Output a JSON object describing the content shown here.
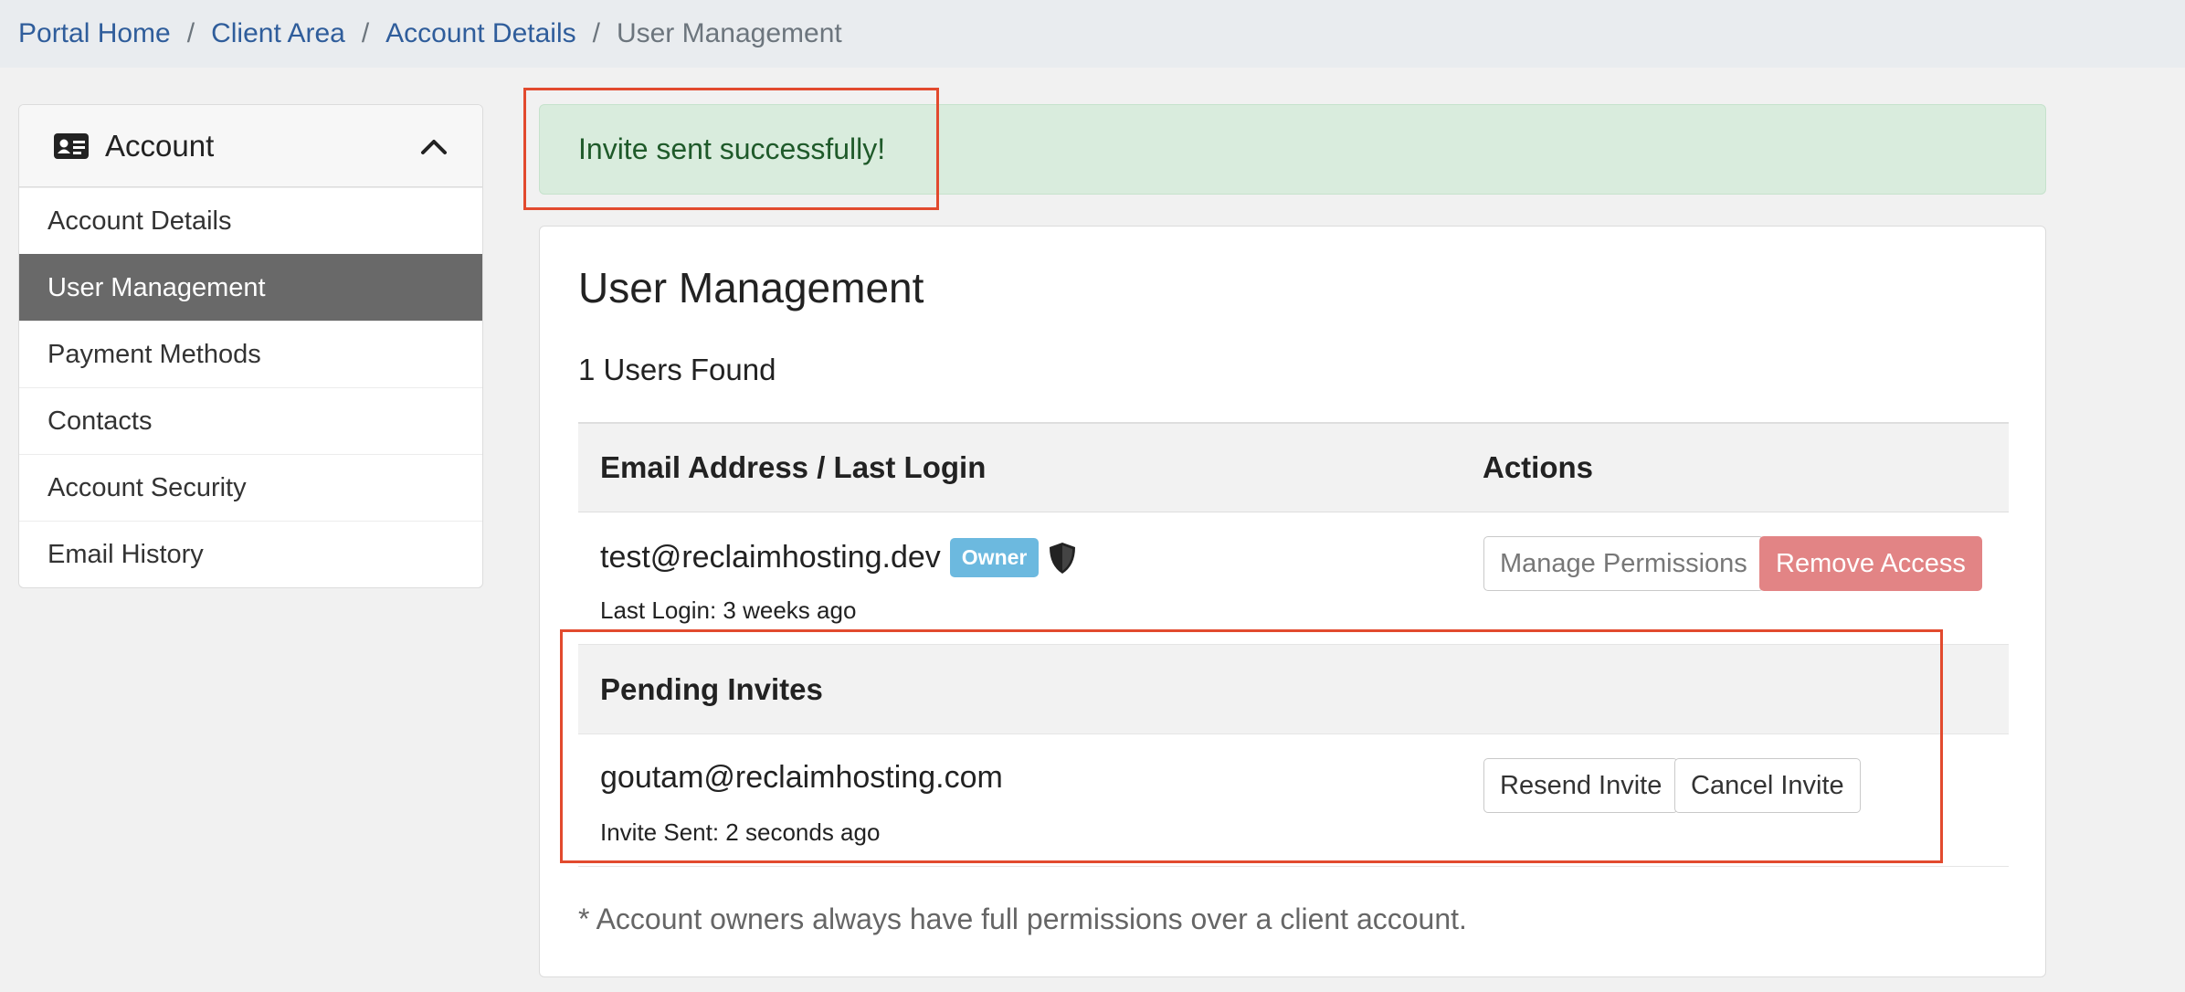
{
  "breadcrumb": [
    {
      "label": "Portal Home"
    },
    {
      "label": "Client Area"
    },
    {
      "label": "Account Details"
    },
    {
      "label": "User Management"
    }
  ],
  "sidebar": {
    "header": "Account",
    "items": [
      {
        "label": "Account Details"
      },
      {
        "label": "User Management"
      },
      {
        "label": "Payment Methods"
      },
      {
        "label": "Contacts"
      },
      {
        "label": "Account Security"
      },
      {
        "label": "Email History"
      }
    ]
  },
  "alert": {
    "message": "Invite sent successfully!"
  },
  "main": {
    "title": "User Management",
    "users_found": "1 Users Found",
    "table": {
      "col_email": "Email Address / Last Login",
      "col_actions": "Actions"
    },
    "user": {
      "email": "test@reclaimhosting.dev",
      "badge": "Owner",
      "last_login": "Last Login: 3 weeks ago",
      "manage_label": "Manage Permissions",
      "remove_label": "Remove Access"
    },
    "pending": {
      "heading": "Pending Invites",
      "email": "goutam@reclaimhosting.com",
      "sent": "Invite Sent: 2 seconds ago",
      "resend_label": "Resend Invite",
      "cancel_label": "Cancel Invite"
    },
    "footnote": "* Account owners always have full permissions over a client account."
  },
  "colors": {
    "link": "#2f5d9b",
    "active_sidebar": "#696969",
    "alert_bg": "#d9ecdd",
    "alert_text": "#1f5a2a",
    "owner_badge": "#6cb9df",
    "danger_button": "#e28485",
    "highlight": "#e24a2e"
  },
  "icons": {
    "sidebar_header": "id-card-icon",
    "collapse": "chevron-up-icon",
    "owner": "shield-icon"
  }
}
